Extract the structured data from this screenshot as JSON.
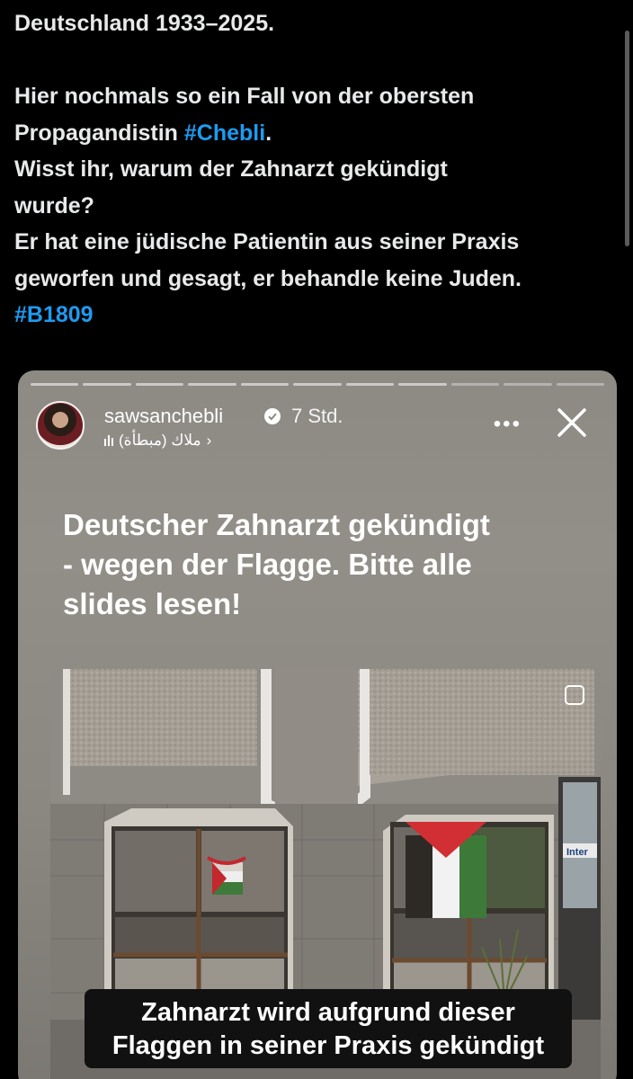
{
  "tweet": {
    "line1": "Deutschland 1933–2025.",
    "line2": "Hier nochmals so ein Fall von der obersten",
    "line3_prefix": "Propagandistin ",
    "line3_hashtag": "#Chebli",
    "line3_suffix": ".",
    "line4": "Wisst ihr, warum der Zahnarzt gekündigt",
    "line5": "wurde?",
    "line6": "Er hat eine jüdische Patientin aus seiner Praxis",
    "line7": "geworfen und gesagt, er behandle keine Juden.",
    "hashtag2": "#B1809"
  },
  "story": {
    "username": "sawsanchebli",
    "time_ago": "7 Std.",
    "music": "ملاك (مبطأة)",
    "music_chevron": "›",
    "more": "•••",
    "headline_line1": "Deutscher Zahnarzt gekündigt",
    "headline_line2": "- wegen der Flagge. Bitte alle",
    "headline_line3": "slides lesen!",
    "caption_line1": "Zahnarzt wird aufgrund dieser",
    "caption_line2": "Flaggen in seiner Praxis gekündigt",
    "sign_text": "Inter"
  },
  "colors": {
    "background": "#000000",
    "text": "#e7e9ea",
    "hashtag": "#1d9bf0",
    "card": "#8d8a84"
  },
  "icons": [
    "verified-badge-icon",
    "audio-bars-icon",
    "more-options-icon",
    "close-icon",
    "select-icon"
  ]
}
